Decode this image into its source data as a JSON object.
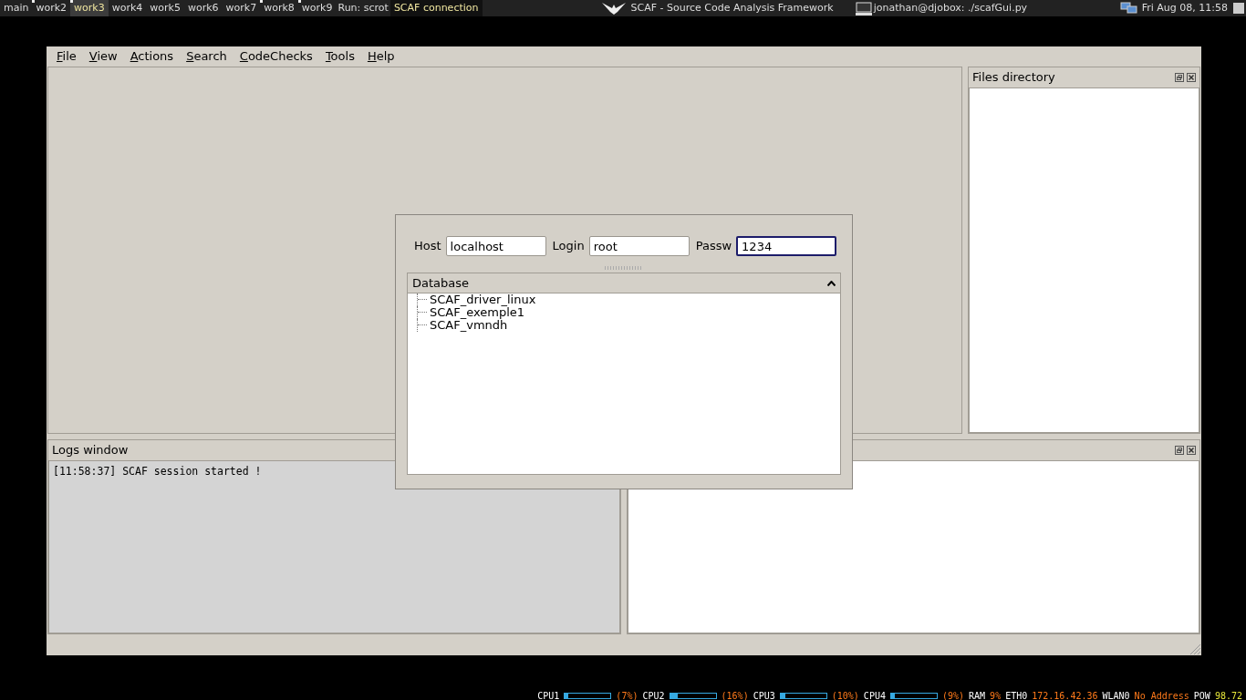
{
  "taskbar": {
    "workspaces": [
      {
        "label": "main",
        "selected": false,
        "occupied": false
      },
      {
        "label": "work2",
        "selected": false,
        "occupied": true
      },
      {
        "label": "work3",
        "selected": true,
        "occupied": true
      },
      {
        "label": "work4",
        "selected": false,
        "occupied": false
      },
      {
        "label": "work5",
        "selected": false,
        "occupied": false
      },
      {
        "label": "work6",
        "selected": false,
        "occupied": false
      },
      {
        "label": "work7",
        "selected": false,
        "occupied": false
      },
      {
        "label": "work8",
        "selected": false,
        "occupied": true
      },
      {
        "label": "work9",
        "selected": false,
        "occupied": true
      }
    ],
    "run_label": "Run: scrot",
    "active_task": "SCAF connection",
    "window_title": "SCAF - Source Code Analysis Framework",
    "terminal_title": "jonathan@djobox: ./scafGui.py",
    "clock": "Fri Aug 08, 11:58"
  },
  "menu": [
    "File",
    "View",
    "Actions",
    "Search",
    "CodeChecks",
    "Tools",
    "Help"
  ],
  "files_dock": {
    "title": "Files directory"
  },
  "logs_dock": {
    "title": "Logs window",
    "lines": [
      "[11:58:37] SCAF session started !"
    ]
  },
  "dialog": {
    "fields": [
      {
        "label": "Host",
        "value": "localhost",
        "focused": false
      },
      {
        "label": "Login",
        "value": "root",
        "focused": false
      },
      {
        "label": "Passw",
        "value": "1234",
        "focused": true
      }
    ],
    "tree_header": "Database",
    "items": [
      "SCAF_driver_linux",
      "SCAF_exemple1",
      "SCAF_vmndh"
    ]
  },
  "status": {
    "meters": [
      {
        "label": "CPU1",
        "level": 0.07,
        "reading": "(7%)"
      },
      {
        "label": "CPU2",
        "level": 0.16,
        "reading": "(16%)"
      },
      {
        "label": "CPU3",
        "level": 0.1,
        "reading": "(10%)"
      },
      {
        "label": "CPU4",
        "level": 0.09,
        "reading": "(9%)"
      }
    ],
    "ram_label": "RAM",
    "ram_value": "9%",
    "eth_label": "ETH0",
    "eth_value": "172.16.42.36",
    "wlan_label": "WLAN0",
    "wlan_value": "No Address",
    "pow_label": "POW",
    "pow_value": "98.72"
  }
}
